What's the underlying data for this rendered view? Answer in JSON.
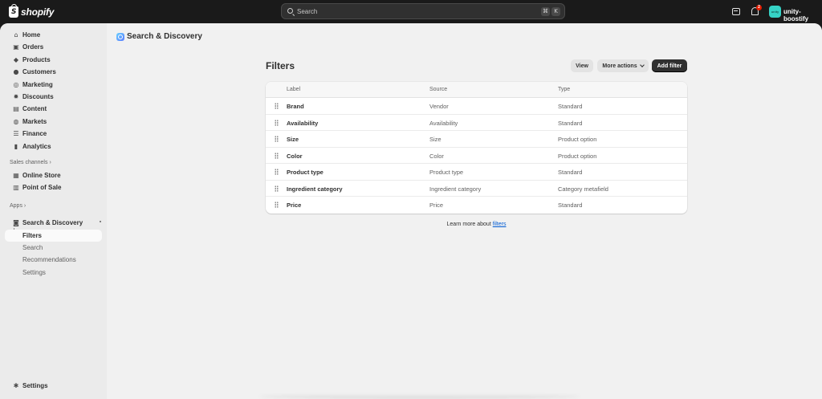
{
  "topbar": {
    "brand": "shopify",
    "search_placeholder": "Search",
    "shortcut_cmd": "⌘",
    "shortcut_key": "K",
    "notification_count": "2",
    "avatar_initials": "unity",
    "store_name": "unity-boostify"
  },
  "sidebar": {
    "items": [
      {
        "label": "Home",
        "icon": "home-icon"
      },
      {
        "label": "Orders",
        "icon": "orders-icon"
      },
      {
        "label": "Products",
        "icon": "tag-icon"
      },
      {
        "label": "Customers",
        "icon": "person-icon"
      },
      {
        "label": "Marketing",
        "icon": "target-icon"
      },
      {
        "label": "Discounts",
        "icon": "discount-icon"
      },
      {
        "label": "Content",
        "icon": "content-icon"
      },
      {
        "label": "Markets",
        "icon": "globe-icon"
      },
      {
        "label": "Finance",
        "icon": "bank-icon"
      },
      {
        "label": "Analytics",
        "icon": "chart-icon"
      }
    ],
    "sales_channels_label": "Sales channels",
    "sales_channels": [
      {
        "label": "Online Store",
        "icon": "online-store-icon"
      },
      {
        "label": "Point of Sale",
        "icon": "pos-icon"
      }
    ],
    "apps_label": "Apps",
    "app": {
      "label": "Search & Discovery",
      "icon": "search-discovery-icon"
    },
    "app_subitems": [
      "Filters",
      "Search",
      "Recommendations",
      "Settings"
    ],
    "settings_label": "Settings"
  },
  "main": {
    "app_title": "Search & Discovery",
    "page_title": "Filters",
    "buttons": {
      "view": "View",
      "more_actions": "More actions",
      "add_filter": "Add filter"
    },
    "table": {
      "headers": {
        "label": "Label",
        "source": "Source",
        "type": "Type"
      },
      "rows": [
        {
          "label": "Brand",
          "source": "Vendor",
          "type": "Standard"
        },
        {
          "label": "Availability",
          "source": "Availability",
          "type": "Standard"
        },
        {
          "label": "Size",
          "source": "Size",
          "type": "Product option"
        },
        {
          "label": "Color",
          "source": "Color",
          "type": "Product option"
        },
        {
          "label": "Product type",
          "source": "Product type",
          "type": "Standard"
        },
        {
          "label": "Ingredient category",
          "source": "Ingredient category",
          "type": "Category metafield"
        },
        {
          "label": "Price",
          "source": "Price",
          "type": "Standard"
        }
      ]
    },
    "learn_more_prefix": "Learn more about",
    "learn_more_link": "filters"
  },
  "colors": {
    "topbar_bg": "#1a1a1a",
    "sidebar_bg": "#ebebeb",
    "main_bg": "#f1f1f1",
    "primary_button": "#303030",
    "link": "#005bd3",
    "avatar_bg": "#36d3c6"
  }
}
